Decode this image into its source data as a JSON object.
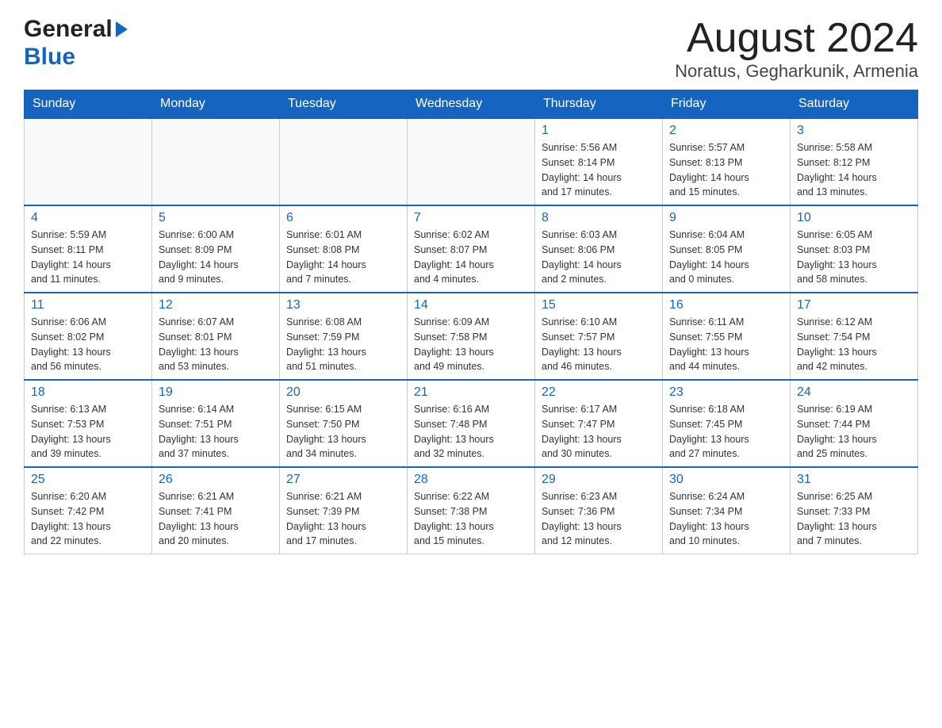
{
  "header": {
    "logo_general": "General",
    "logo_blue": "Blue",
    "month_year": "August 2024",
    "location": "Noratus, Gegharkunik, Armenia"
  },
  "days_of_week": [
    "Sunday",
    "Monday",
    "Tuesday",
    "Wednesday",
    "Thursday",
    "Friday",
    "Saturday"
  ],
  "weeks": [
    [
      {
        "day": "",
        "info": ""
      },
      {
        "day": "",
        "info": ""
      },
      {
        "day": "",
        "info": ""
      },
      {
        "day": "",
        "info": ""
      },
      {
        "day": "1",
        "info": "Sunrise: 5:56 AM\nSunset: 8:14 PM\nDaylight: 14 hours\nand 17 minutes."
      },
      {
        "day": "2",
        "info": "Sunrise: 5:57 AM\nSunset: 8:13 PM\nDaylight: 14 hours\nand 15 minutes."
      },
      {
        "day": "3",
        "info": "Sunrise: 5:58 AM\nSunset: 8:12 PM\nDaylight: 14 hours\nand 13 minutes."
      }
    ],
    [
      {
        "day": "4",
        "info": "Sunrise: 5:59 AM\nSunset: 8:11 PM\nDaylight: 14 hours\nand 11 minutes."
      },
      {
        "day": "5",
        "info": "Sunrise: 6:00 AM\nSunset: 8:09 PM\nDaylight: 14 hours\nand 9 minutes."
      },
      {
        "day": "6",
        "info": "Sunrise: 6:01 AM\nSunset: 8:08 PM\nDaylight: 14 hours\nand 7 minutes."
      },
      {
        "day": "7",
        "info": "Sunrise: 6:02 AM\nSunset: 8:07 PM\nDaylight: 14 hours\nand 4 minutes."
      },
      {
        "day": "8",
        "info": "Sunrise: 6:03 AM\nSunset: 8:06 PM\nDaylight: 14 hours\nand 2 minutes."
      },
      {
        "day": "9",
        "info": "Sunrise: 6:04 AM\nSunset: 8:05 PM\nDaylight: 14 hours\nand 0 minutes."
      },
      {
        "day": "10",
        "info": "Sunrise: 6:05 AM\nSunset: 8:03 PM\nDaylight: 13 hours\nand 58 minutes."
      }
    ],
    [
      {
        "day": "11",
        "info": "Sunrise: 6:06 AM\nSunset: 8:02 PM\nDaylight: 13 hours\nand 56 minutes."
      },
      {
        "day": "12",
        "info": "Sunrise: 6:07 AM\nSunset: 8:01 PM\nDaylight: 13 hours\nand 53 minutes."
      },
      {
        "day": "13",
        "info": "Sunrise: 6:08 AM\nSunset: 7:59 PM\nDaylight: 13 hours\nand 51 minutes."
      },
      {
        "day": "14",
        "info": "Sunrise: 6:09 AM\nSunset: 7:58 PM\nDaylight: 13 hours\nand 49 minutes."
      },
      {
        "day": "15",
        "info": "Sunrise: 6:10 AM\nSunset: 7:57 PM\nDaylight: 13 hours\nand 46 minutes."
      },
      {
        "day": "16",
        "info": "Sunrise: 6:11 AM\nSunset: 7:55 PM\nDaylight: 13 hours\nand 44 minutes."
      },
      {
        "day": "17",
        "info": "Sunrise: 6:12 AM\nSunset: 7:54 PM\nDaylight: 13 hours\nand 42 minutes."
      }
    ],
    [
      {
        "day": "18",
        "info": "Sunrise: 6:13 AM\nSunset: 7:53 PM\nDaylight: 13 hours\nand 39 minutes."
      },
      {
        "day": "19",
        "info": "Sunrise: 6:14 AM\nSunset: 7:51 PM\nDaylight: 13 hours\nand 37 minutes."
      },
      {
        "day": "20",
        "info": "Sunrise: 6:15 AM\nSunset: 7:50 PM\nDaylight: 13 hours\nand 34 minutes."
      },
      {
        "day": "21",
        "info": "Sunrise: 6:16 AM\nSunset: 7:48 PM\nDaylight: 13 hours\nand 32 minutes."
      },
      {
        "day": "22",
        "info": "Sunrise: 6:17 AM\nSunset: 7:47 PM\nDaylight: 13 hours\nand 30 minutes."
      },
      {
        "day": "23",
        "info": "Sunrise: 6:18 AM\nSunset: 7:45 PM\nDaylight: 13 hours\nand 27 minutes."
      },
      {
        "day": "24",
        "info": "Sunrise: 6:19 AM\nSunset: 7:44 PM\nDaylight: 13 hours\nand 25 minutes."
      }
    ],
    [
      {
        "day": "25",
        "info": "Sunrise: 6:20 AM\nSunset: 7:42 PM\nDaylight: 13 hours\nand 22 minutes."
      },
      {
        "day": "26",
        "info": "Sunrise: 6:21 AM\nSunset: 7:41 PM\nDaylight: 13 hours\nand 20 minutes."
      },
      {
        "day": "27",
        "info": "Sunrise: 6:21 AM\nSunset: 7:39 PM\nDaylight: 13 hours\nand 17 minutes."
      },
      {
        "day": "28",
        "info": "Sunrise: 6:22 AM\nSunset: 7:38 PM\nDaylight: 13 hours\nand 15 minutes."
      },
      {
        "day": "29",
        "info": "Sunrise: 6:23 AM\nSunset: 7:36 PM\nDaylight: 13 hours\nand 12 minutes."
      },
      {
        "day": "30",
        "info": "Sunrise: 6:24 AM\nSunset: 7:34 PM\nDaylight: 13 hours\nand 10 minutes."
      },
      {
        "day": "31",
        "info": "Sunrise: 6:25 AM\nSunset: 7:33 PM\nDaylight: 13 hours\nand 7 minutes."
      }
    ]
  ]
}
